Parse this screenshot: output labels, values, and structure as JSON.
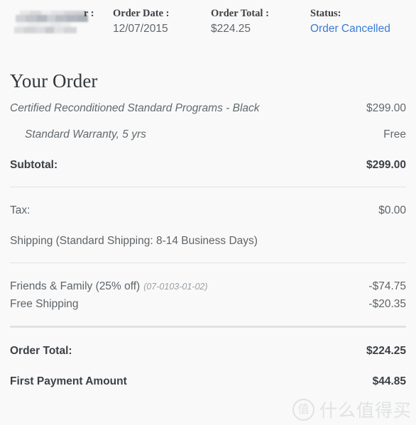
{
  "header": {
    "order_number": {
      "label": "r :",
      "value": "",
      "redacted": true
    },
    "order_date": {
      "label": "Order Date :",
      "value": "12/07/2015"
    },
    "order_total": {
      "label": "Order Total :",
      "value": "$224.25"
    },
    "status": {
      "label": "Status:",
      "value": "Order Cancelled",
      "link_color": "#3a7bd5"
    }
  },
  "section": {
    "title": "Your Order"
  },
  "line_items": [
    {
      "label": "Certified Reconditioned Standard Programs - Black",
      "value": "$299.00",
      "indented": false
    },
    {
      "label": "Standard Warranty, 5 yrs",
      "value": "Free",
      "indented": true
    }
  ],
  "subtotal": {
    "label": "Subtotal:",
    "value": "$299.00"
  },
  "tax": {
    "label": "Tax:",
    "value": "$0.00"
  },
  "shipping": {
    "label": "Shipping (Standard Shipping: 8-14 Business Days)",
    "value": ""
  },
  "discounts": [
    {
      "label": "Friends & Family (25% off)",
      "code": "(07-0103-01-02)",
      "value": "-$74.75"
    },
    {
      "label": "Free Shipping",
      "code": "",
      "value": "-$20.35"
    }
  ],
  "order_total": {
    "label": "Order Total:",
    "value": "$224.25"
  },
  "first_payment": {
    "label": "First Payment Amount",
    "value": "$44.85"
  },
  "watermark": {
    "badge": "值",
    "text": "什么值得买"
  }
}
